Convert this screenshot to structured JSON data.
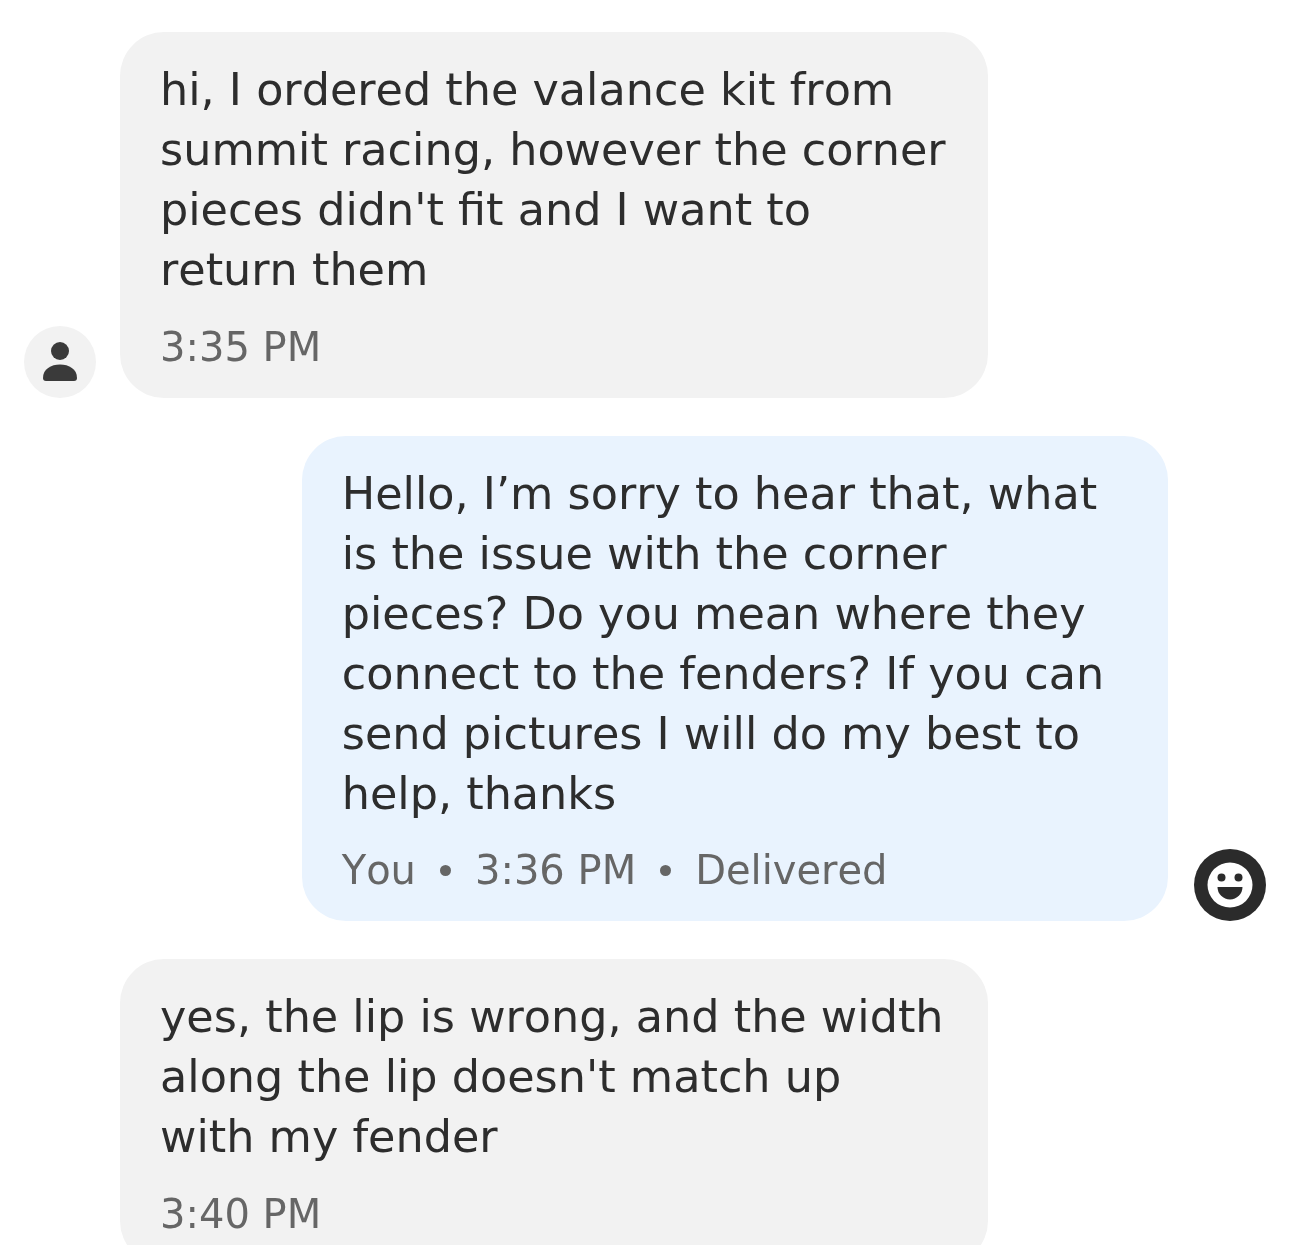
{
  "messages": [
    {
      "kind": "incoming",
      "text": "hi, I ordered the valance kit from summit racing, however the corner pieces didn't fit and I want to return them",
      "time": "3:35 PM",
      "show_avatar": true
    },
    {
      "kind": "outgoing",
      "text": "Hello, I’m sorry to hear that, what is the issue with the corner pieces? Do you mean where they connect to the fenders? If you can send pictures I will do my best to help, thanks",
      "sender": "You",
      "time": "3:36 PM",
      "status": "Delivered",
      "show_reaction_button": true
    },
    {
      "kind": "incoming",
      "text": "yes, the lip is wrong, and the width along the lip doesn't match up with my fender",
      "time": "3:40 PM",
      "show_avatar": false
    }
  ]
}
